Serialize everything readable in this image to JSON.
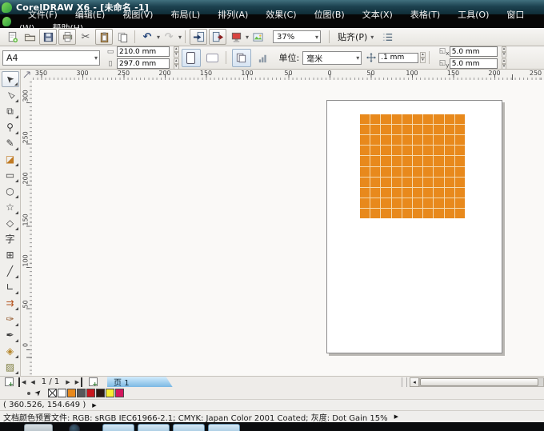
{
  "window": {
    "title": "CorelDRAW X6 - [未命名 -1]"
  },
  "menu": [
    "文件(F)",
    "编辑(E)",
    "视图(V)",
    "布局(L)",
    "排列(A)",
    "效果(C)",
    "位图(B)",
    "文本(X)",
    "表格(T)",
    "工具(O)",
    "窗口(W)",
    "帮助(H)"
  ],
  "toolbar": {
    "zoom_level": "37%",
    "snap_label": "贴齐(P)",
    "buttons": [
      {
        "name": "new-document-button",
        "icon": "new"
      },
      {
        "name": "open-button",
        "icon": "folder"
      },
      {
        "name": "save-button",
        "icon": "save",
        "framed": true
      },
      {
        "name": "print-button",
        "icon": "print",
        "framed": true
      },
      {
        "name": "cut-button",
        "icon": "cut"
      },
      {
        "name": "paste-button",
        "icon": "paste",
        "framed": true
      },
      {
        "name": "copy-button",
        "icon": "copy"
      },
      {
        "name": "separator"
      },
      {
        "name": "undo-button",
        "icon": "undo",
        "dropdown": true
      },
      {
        "name": "redo-button",
        "icon": "redo",
        "dropdown": true,
        "disabled": true
      },
      {
        "name": "separator"
      },
      {
        "name": "import-button",
        "icon": "import",
        "framed": true
      },
      {
        "name": "export-button",
        "icon": "export",
        "framed": true
      },
      {
        "name": "application-launcher-button",
        "icon": "launcher",
        "dropdown": true
      },
      {
        "name": "welcome-screen-button",
        "icon": "welcome"
      }
    ]
  },
  "property_bar": {
    "paper_size": "A4",
    "paper_width": "210.0 mm",
    "paper_height": "297.0 mm",
    "units_label": "单位:",
    "units_value": "毫米",
    "nudge_offset": ".1 mm",
    "duplicate_x": "5.0 mm",
    "duplicate_y": "5.0 mm"
  },
  "rulers": {
    "horizontal": [
      350,
      300,
      250,
      200,
      150,
      100,
      50,
      0,
      50,
      100,
      150,
      200,
      250
    ],
    "vertical": [
      300,
      250,
      200,
      150,
      100,
      50,
      0
    ]
  },
  "toolbox": [
    {
      "name": "pick-tool",
      "glyph": "➤",
      "rot": -135,
      "selected": true,
      "flyout": true
    },
    {
      "name": "shape-tool",
      "glyph": "▻",
      "rot": -135,
      "flyout": true
    },
    {
      "name": "crop-tool",
      "glyph": "⧉",
      "flyout": true
    },
    {
      "name": "zoom-tool",
      "glyph": "⚲",
      "flyout": true
    },
    {
      "name": "freehand-tool",
      "glyph": "✎",
      "flyout": true
    },
    {
      "name": "smart-fill-tool",
      "glyph": "◪",
      "color": "#c07a22",
      "flyout": true
    },
    {
      "name": "rectangle-tool",
      "glyph": "▭",
      "flyout": true
    },
    {
      "name": "ellipse-tool",
      "glyph": "○",
      "flyout": true
    },
    {
      "name": "polygon-tool",
      "glyph": "☆",
      "flyout": true
    },
    {
      "name": "basic-shapes-tool",
      "glyph": "◇",
      "flyout": true
    },
    {
      "name": "text-tool",
      "glyph": "字"
    },
    {
      "name": "table-tool",
      "glyph": "⊞"
    },
    {
      "name": "dimension-tool",
      "glyph": "╱",
      "flyout": true
    },
    {
      "name": "connector-tool",
      "glyph": "∟",
      "flyout": true
    },
    {
      "name": "blend-tool",
      "glyph": "⇉",
      "color": "#b5541f",
      "flyout": true
    },
    {
      "name": "color-eyedropper-tool",
      "glyph": "✑",
      "color": "#8a4a1a",
      "flyout": true
    },
    {
      "name": "outline-pen-tool",
      "glyph": "✒",
      "flyout": true
    },
    {
      "name": "fill-tool",
      "glyph": "◈",
      "color": "#b5862a",
      "flyout": true
    },
    {
      "name": "interactive-fill-tool",
      "glyph": "▨",
      "color": "#7a7a3a",
      "flyout": true
    }
  ],
  "canvas": {
    "grid": {
      "rows": 10,
      "cols": 10,
      "cell_color": "#E8891C",
      "line_color": "#F5D9AC"
    }
  },
  "page_nav": {
    "counter": "1 / 1",
    "tab": "页 1"
  },
  "palette": {
    "colors": [
      "#FFFFFF",
      "#E8891C",
      "#57585A",
      "#C9171E",
      "#2E1A13",
      "#F9EE31",
      "#D3175E"
    ]
  },
  "status": {
    "coordinates": "( 360.526, 154.649 )",
    "profile": "文档颜色预置文件: RGB: sRGB IEC61966-2.1; CMYK: Japan Color 2001 Coated; 灰度: Dot Gain 15%"
  }
}
